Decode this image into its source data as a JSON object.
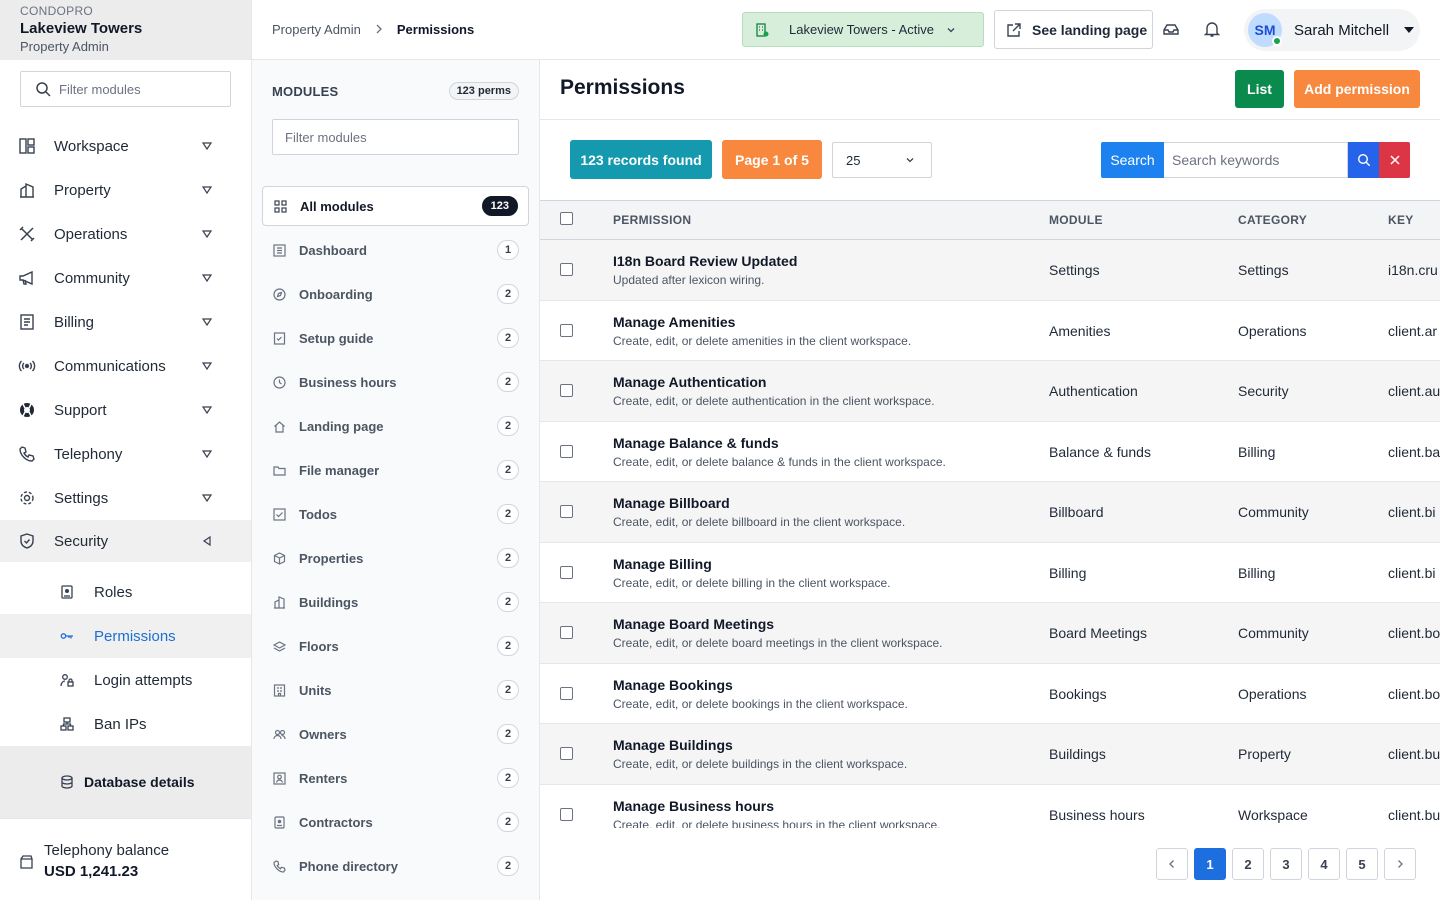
{
  "brand": {
    "kicker": "CONDOPRO",
    "name": "Lakeview Towers",
    "role": "Property Admin"
  },
  "sidebar": {
    "filter_placeholder": "Filter modules",
    "items": [
      {
        "label": "Workspace",
        "icon": "workspace-icon"
      },
      {
        "label": "Property",
        "icon": "property-icon"
      },
      {
        "label": "Operations",
        "icon": "tools-icon"
      },
      {
        "label": "Community",
        "icon": "megaphone-icon"
      },
      {
        "label": "Billing",
        "icon": "billing-icon"
      },
      {
        "label": "Communications",
        "icon": "broadcast-icon"
      },
      {
        "label": "Support",
        "icon": "lifebuoy-icon"
      },
      {
        "label": "Telephony",
        "icon": "phone-icon"
      },
      {
        "label": "Settings",
        "icon": "gear-icon"
      },
      {
        "label": "Security",
        "icon": "shield-icon",
        "expanded": true
      }
    ],
    "security_children": [
      {
        "label": "Roles",
        "icon": "badge-icon"
      },
      {
        "label": "Permissions",
        "icon": "key-icon",
        "active": true
      },
      {
        "label": "Login attempts",
        "icon": "user-lock-icon"
      },
      {
        "label": "Ban IPs",
        "icon": "network-icon"
      }
    ],
    "database_details": "Database details",
    "balance_label": "Telephony balance",
    "balance_value": "USD 1,241.23"
  },
  "topbar": {
    "breadcrumb": [
      "Property Admin",
      "Permissions"
    ],
    "property_selector": "Lakeview Towers - Active",
    "landing_button": "See landing page",
    "user_initials": "SM",
    "user_name": "Sarah Mitchell"
  },
  "modules": {
    "title": "MODULES",
    "perms_badge": "123 perms",
    "filter_placeholder": "Filter modules",
    "items": [
      {
        "label": "All modules",
        "count": "123",
        "icon": "grid-icon",
        "active": true
      },
      {
        "label": "Dashboard",
        "count": "1",
        "icon": "dashboard-icon"
      },
      {
        "label": "Onboarding",
        "count": "2",
        "icon": "compass-icon"
      },
      {
        "label": "Setup guide",
        "count": "2",
        "icon": "checklist-icon"
      },
      {
        "label": "Business hours",
        "count": "2",
        "icon": "clock-icon"
      },
      {
        "label": "Landing page",
        "count": "2",
        "icon": "home-icon"
      },
      {
        "label": "File manager",
        "count": "2",
        "icon": "folder-icon"
      },
      {
        "label": "Todos",
        "count": "2",
        "icon": "check-square-icon"
      },
      {
        "label": "Properties",
        "count": "2",
        "icon": "box-icon"
      },
      {
        "label": "Buildings",
        "count": "2",
        "icon": "building-icon"
      },
      {
        "label": "Floors",
        "count": "2",
        "icon": "layers-icon"
      },
      {
        "label": "Units",
        "count": "2",
        "icon": "unit-icon"
      },
      {
        "label": "Owners",
        "count": "2",
        "icon": "users-icon"
      },
      {
        "label": "Renters",
        "count": "2",
        "icon": "user-icon"
      },
      {
        "label": "Contractors",
        "count": "2",
        "icon": "badge-icon"
      },
      {
        "label": "Phone directory",
        "count": "2",
        "icon": "phone-icon"
      }
    ]
  },
  "main": {
    "title": "Permissions",
    "list_button": "List",
    "add_button": "Add permission",
    "records_badge": "123 records found",
    "page_badge": "Page 1 of 5",
    "per_page": "25",
    "search_label": "Search",
    "search_placeholder": "Search keywords",
    "columns": [
      "PERMISSION",
      "MODULE",
      "CATEGORY",
      "KEY"
    ],
    "rows": [
      {
        "name": "I18n Board Review Updated",
        "desc": "Updated after lexicon wiring.",
        "module": "Settings",
        "category": "Settings",
        "key": "i18n.cru"
      },
      {
        "name": "Manage Amenities",
        "desc": "Create, edit, or delete amenities in the client workspace.",
        "module": "Amenities",
        "category": "Operations",
        "key": "client.ar"
      },
      {
        "name": "Manage Authentication",
        "desc": "Create, edit, or delete authentication in the client workspace.",
        "module": "Authentication",
        "category": "Security",
        "key": "client.au"
      },
      {
        "name": "Manage Balance & funds",
        "desc": "Create, edit, or delete balance & funds in the client workspace.",
        "module": "Balance & funds",
        "category": "Billing",
        "key": "client.ba"
      },
      {
        "name": "Manage Billboard",
        "desc": "Create, edit, or delete billboard in the client workspace.",
        "module": "Billboard",
        "category": "Community",
        "key": "client.bi"
      },
      {
        "name": "Manage Billing",
        "desc": "Create, edit, or delete billing in the client workspace.",
        "module": "Billing",
        "category": "Billing",
        "key": "client.bi"
      },
      {
        "name": "Manage Board Meetings",
        "desc": "Create, edit, or delete board meetings in the client workspace.",
        "module": "Board Meetings",
        "category": "Community",
        "key": "client.bo"
      },
      {
        "name": "Manage Bookings",
        "desc": "Create, edit, or delete bookings in the client workspace.",
        "module": "Bookings",
        "category": "Operations",
        "key": "client.bo"
      },
      {
        "name": "Manage Buildings",
        "desc": "Create, edit, or delete buildings in the client workspace.",
        "module": "Buildings",
        "category": "Property",
        "key": "client.bu"
      },
      {
        "name": "Manage Business hours",
        "desc": "Create, edit, or delete business hours in the client workspace.",
        "module": "Business hours",
        "category": "Workspace",
        "key": "client.bu"
      }
    ],
    "pagination": [
      "1",
      "2",
      "3",
      "4",
      "5"
    ]
  }
}
